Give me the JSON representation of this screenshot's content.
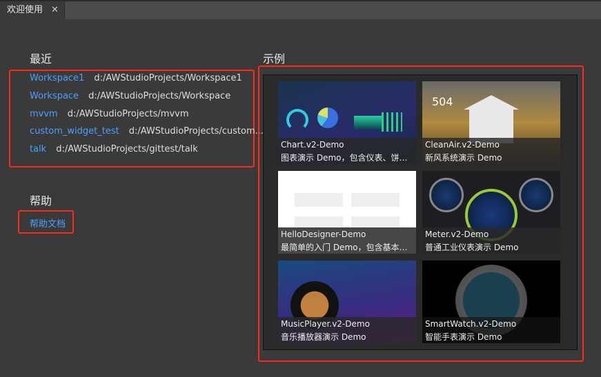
{
  "tab": {
    "title": "欢迎使用",
    "close": "✕"
  },
  "recent": {
    "heading": "最近",
    "items": [
      {
        "name": "Workspace1",
        "path": "d:/AWStudioProjects/Workspace1"
      },
      {
        "name": "Workspace",
        "path": "d:/AWStudioProjects/Workspace"
      },
      {
        "name": "mvvm",
        "path": "d:/AWStudioProjects/mvvm"
      },
      {
        "name": "custom_widget_test",
        "path": "d:/AWStudioProjects/custom..."
      },
      {
        "name": "talk",
        "path": "d:/AWStudioProjects/gittest/talk"
      }
    ]
  },
  "help": {
    "heading": "帮助",
    "link": "帮助文档"
  },
  "examples": {
    "heading": "示例",
    "items": [
      {
        "title": "Chart.v2-Demo",
        "desc": "图表演示  Demo，包含仪表、饼图、..."
      },
      {
        "title": "CleanAir.v2-Demo",
        "desc": "新风系统演示  Demo"
      },
      {
        "title": "HelloDesigner-Demo",
        "desc": "最简单的入门  Demo，包含基本的文..."
      },
      {
        "title": "Meter.v2-Demo",
        "desc": "普通工业仪表演示  Demo"
      },
      {
        "title": "MusicPlayer.v2-Demo",
        "desc": "音乐播放器演示  Demo"
      },
      {
        "title": "SmartWatch.v2-Demo",
        "desc": "智能手表演示  Demo"
      }
    ]
  },
  "colors": {
    "link": "#4aa0ff",
    "highlight": "#ff2a1a"
  }
}
